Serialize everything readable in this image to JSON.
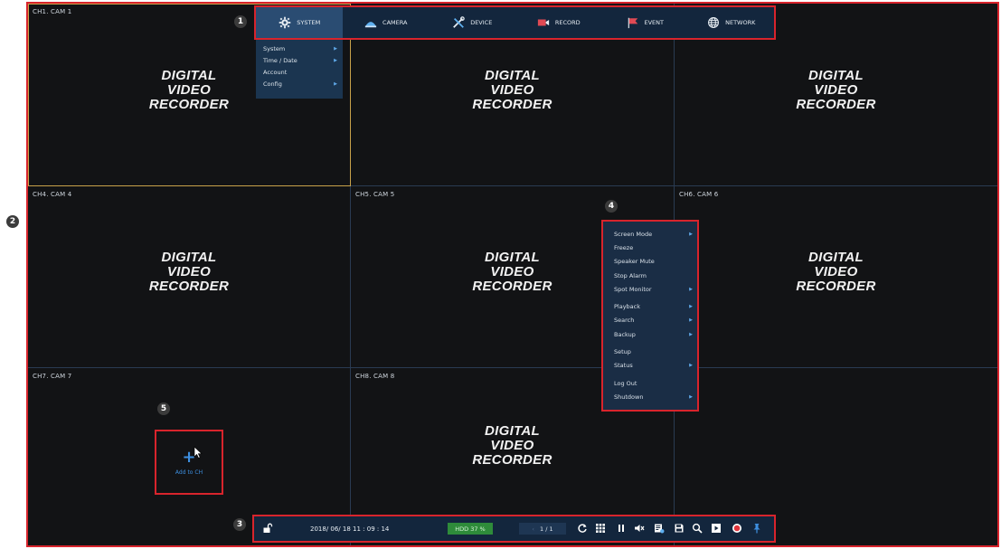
{
  "markers": [
    "1",
    "2",
    "3",
    "4",
    "5"
  ],
  "topmenu": {
    "items": [
      {
        "label": "SYSTEM",
        "icon": "gear-icon"
      },
      {
        "label": "CAMERA",
        "icon": "camera-icon"
      },
      {
        "label": "DEVICE",
        "icon": "tools-icon"
      },
      {
        "label": "RECORD",
        "icon": "record-icon"
      },
      {
        "label": "EVENT",
        "icon": "flag-icon"
      },
      {
        "label": "NETWORK",
        "icon": "globe-icon"
      }
    ]
  },
  "system_menu": {
    "items": [
      {
        "label": "System",
        "has_submenu": true
      },
      {
        "label": "Time / Date",
        "has_submenu": true
      },
      {
        "label": "Account",
        "has_submenu": false
      },
      {
        "label": "Config",
        "has_submenu": true
      }
    ]
  },
  "cameras": [
    {
      "label": "CH1. CAM 1",
      "logo": [
        "DIGITAL",
        "VIDEO",
        "RECORDER"
      ]
    },
    {
      "label": "",
      "logo": [
        "DIGITAL",
        "VIDEO",
        "RECORDER"
      ]
    },
    {
      "label": "",
      "logo": [
        "DIGITAL",
        "VIDEO",
        "RECORDER"
      ]
    },
    {
      "label": "CH4. CAM 4",
      "logo": [
        "DIGITAL",
        "VIDEO",
        "RECORDER"
      ]
    },
    {
      "label": "CH5. CAM 5",
      "logo": [
        "DIGITAL",
        "VIDEO",
        "RECORDER"
      ]
    },
    {
      "label": "CH6. CAM 6",
      "logo": [
        "DIGITAL",
        "VIDEO",
        "RECORDER"
      ]
    },
    {
      "label": "CH7. CAM 7",
      "logo": [
        "",
        "",
        ""
      ]
    },
    {
      "label": "CH8. CAM 8",
      "logo": [
        "DIGITAL",
        "VIDEO",
        "RECORDER"
      ]
    },
    {
      "label": "",
      "logo": [
        "",
        "",
        ""
      ]
    }
  ],
  "context_menu": {
    "items": [
      {
        "label": "Screen Mode",
        "has_submenu": true
      },
      {
        "label": "Freeze",
        "has_submenu": false
      },
      {
        "label": "Speaker Mute",
        "has_submenu": false
      },
      {
        "label": "Stop Alarm",
        "has_submenu": false
      },
      {
        "label": "Spot Monitor",
        "has_submenu": true
      },
      {
        "label": "Playback",
        "has_submenu": true
      },
      {
        "label": "Search",
        "has_submenu": true
      },
      {
        "label": "Backup",
        "has_submenu": true
      },
      {
        "label": "Setup",
        "has_submenu": false
      },
      {
        "label": "Status",
        "has_submenu": true
      },
      {
        "label": "Log Out",
        "has_submenu": false
      },
      {
        "label": "Shutdown",
        "has_submenu": true
      }
    ]
  },
  "add_channel": {
    "label": "Add to CH"
  },
  "bottombar": {
    "datetime": "2018/ 06/ 18  11 : 09 : 14",
    "hdd": "HDD  37 %",
    "page": "1 / 1",
    "icons": [
      "unlock-icon",
      "sequence-icon",
      "grid-icon",
      "pause-icon",
      "mute-icon",
      "event-list-icon",
      "save-icon",
      "search-icon",
      "playback-icon",
      "record-icon",
      "pin-icon"
    ]
  },
  "colors": {
    "highlight": "#d8242c",
    "menu_bg": "#13263d",
    "accent": "#3d8fe0",
    "hdd_green": "#2e8b3a"
  }
}
